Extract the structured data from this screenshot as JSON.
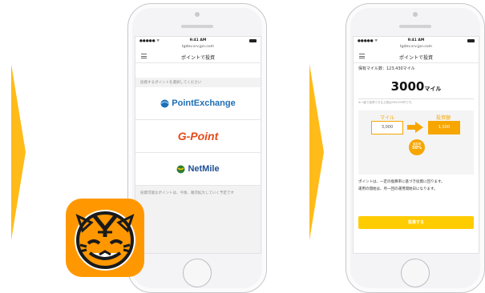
{
  "colors": {
    "accent": "#ffb400",
    "arrow": "#f7a600",
    "app_icon": "#ff9800"
  },
  "phone1": {
    "status_time": "9:41 AM",
    "url": "tgdev.srv.jpn.com",
    "nav_title": "ポイントで投資",
    "section_label": "投資するポイントを選択してください",
    "brands": [
      {
        "name": "PointExchange",
        "icon": "globe-icon",
        "color": "#1f6fb5"
      },
      {
        "name": "G-Point",
        "icon": "g-logo-icon",
        "color": "#e64a19"
      },
      {
        "name": "NetMile",
        "icon": "globe-icon",
        "color": "#1f6fb5"
      }
    ],
    "footnote": "投資可能なポイントは、今後、順次拡大していく予定です"
  },
  "phone2": {
    "status_time": "9:41 AM",
    "url": "tgdev.srv.jpn.com",
    "nav_title": "ポイントで投資",
    "holding": "保有マイル数：123,430マイル",
    "amount": "3000",
    "amount_unit": "マイル",
    "amount_note": "※一度で投資できる上限は999,999円です。",
    "from_label": "マイル",
    "from_value": "3,000",
    "to_label": "投資額",
    "to_value": "1,500",
    "rate_label": "換算率",
    "rate_value": "50%",
    "description_line1": "ポイントは、一定の換算率に基づき投資に回ります。",
    "description_line2": "運用の開始は、月一回の運用開始日になります。",
    "invest_button": "投資する"
  }
}
